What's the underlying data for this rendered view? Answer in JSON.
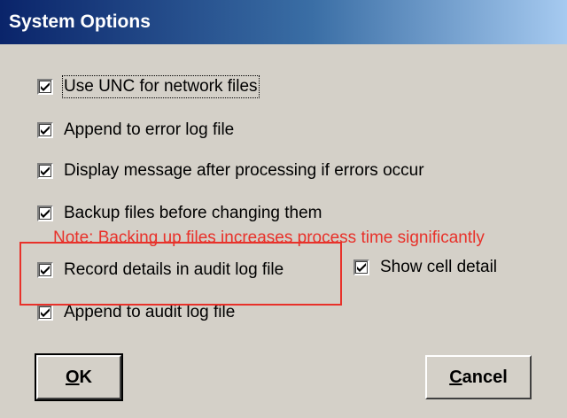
{
  "window": {
    "title": "System Options"
  },
  "options": [
    {
      "label": "Use UNC for network files",
      "checked": true
    },
    {
      "label": "Append to error log file",
      "checked": true
    },
    {
      "label": "Display message after processing if errors occur",
      "checked": true
    },
    {
      "label": "Backup files before changing them",
      "checked": true
    },
    {
      "label": "Record details in audit log file",
      "checked": true
    },
    {
      "label": "Show cell detail",
      "checked": true
    },
    {
      "label": "Append to audit log file",
      "checked": true
    }
  ],
  "note": "Note: Backing up files increases process time significantly",
  "buttons": {
    "ok": {
      "mnemonic": "O",
      "rest": "K"
    },
    "cancel": {
      "mnemonic": "C",
      "rest": "ancel"
    }
  },
  "colors": {
    "annotation_red": "#e8312a",
    "titlebar_start": "#0a246a",
    "titlebar_end": "#a6caf0"
  }
}
